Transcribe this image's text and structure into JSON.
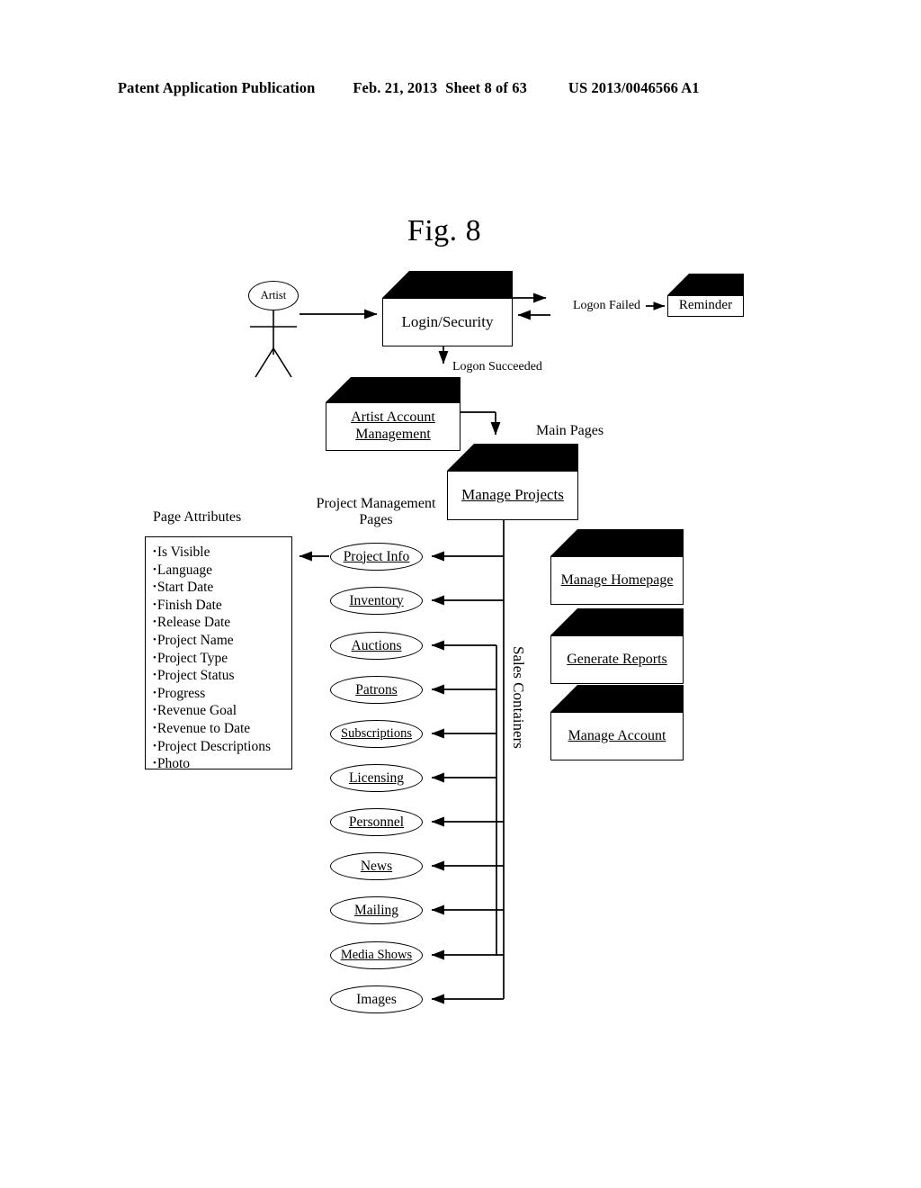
{
  "header": {
    "title": "Patent Application Publication",
    "date": "Feb. 21, 2013",
    "sheet": "Sheet 8 of 63",
    "patent_number": "US 2013/0046566 A1"
  },
  "figure": {
    "caption": "Fig. 8"
  },
  "actor": {
    "label": "Artist"
  },
  "flow": {
    "login_box": "Login/Security",
    "logon_succeeded": "Logon Succeeded",
    "logon_failed": "Logon Failed",
    "reminder_box": "Reminder",
    "artist_account_management": "Artist Account\nManagement",
    "artist_account_management_line1": "Artist Account",
    "artist_account_management_line2": "Management",
    "main_pages_label": "Main Pages",
    "manage_projects_box": "Manage Projects",
    "project_management_pages_line1": "Project Management",
    "project_management_pages_line2": "Pages",
    "sales_containers_label": "Sales Containers"
  },
  "page_attributes": {
    "title": "Page Attributes",
    "items": [
      "Is Visible",
      "Language",
      "Start Date",
      "Finish Date",
      "Release Date",
      "Project Name",
      "Project Type",
      "Project Status",
      "Progress",
      "Revenue Goal",
      "Revenue to Date",
      "Project Descriptions",
      "Photo"
    ]
  },
  "project_pages": [
    {
      "label": "Project Info"
    },
    {
      "label": "Inventory"
    },
    {
      "label": "Auctions"
    },
    {
      "label": "Patrons"
    },
    {
      "label": "Subscriptions"
    },
    {
      "label": "Licensing"
    },
    {
      "label": "Personnel"
    },
    {
      "label": "News"
    },
    {
      "label": "Mailing"
    },
    {
      "label": "Media Shows"
    },
    {
      "label": "Images"
    }
  ],
  "main_pages": [
    {
      "label": "Manage Homepage"
    },
    {
      "label": "Generate Reports"
    },
    {
      "label": "Manage Account"
    }
  ],
  "colors": {
    "ink": "#000000",
    "paper": "#ffffff"
  }
}
